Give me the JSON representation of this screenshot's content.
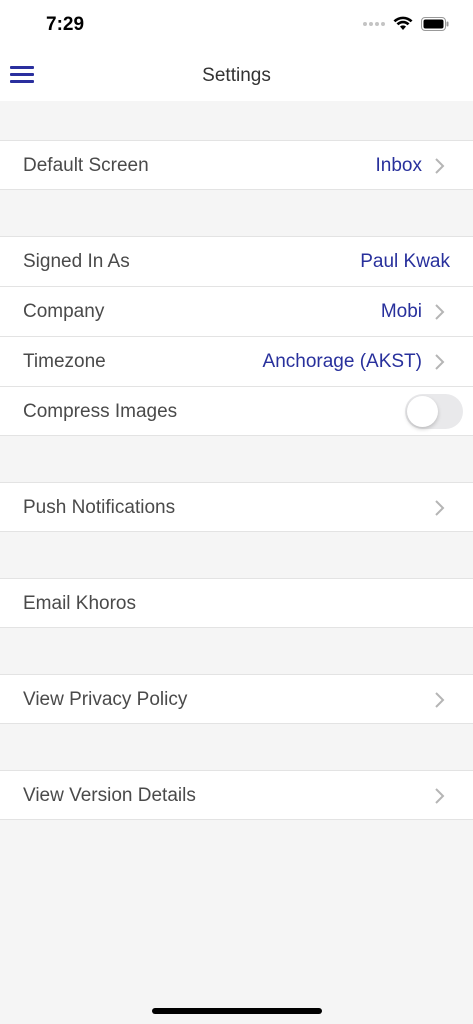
{
  "status_bar": {
    "time": "7:29"
  },
  "nav": {
    "title": "Settings"
  },
  "rows": {
    "default_screen": {
      "label": "Default Screen",
      "value": "Inbox"
    },
    "signed_in_as": {
      "label": "Signed In As",
      "value": "Paul Kwak"
    },
    "company": {
      "label": "Company",
      "value": "Mobi"
    },
    "timezone": {
      "label": "Timezone",
      "value": "Anchorage (AKST)"
    },
    "compress_images": {
      "label": "Compress Images",
      "enabled": false
    },
    "push_notifications": {
      "label": "Push Notifications"
    },
    "email_khoros": {
      "label": "Email Khoros"
    },
    "privacy_policy": {
      "label": "View Privacy Policy"
    },
    "version_details": {
      "label": "View Version Details"
    }
  },
  "icons": {
    "menu": "hamburger-menu-icon",
    "chevron": "chevron-right-icon",
    "wifi": "wifi-icon",
    "battery": "battery-icon"
  },
  "colors": {
    "accent": "#28309c",
    "background": "#f5f5f5",
    "row_background": "#ffffff",
    "label_text": "#4a4a4a"
  }
}
